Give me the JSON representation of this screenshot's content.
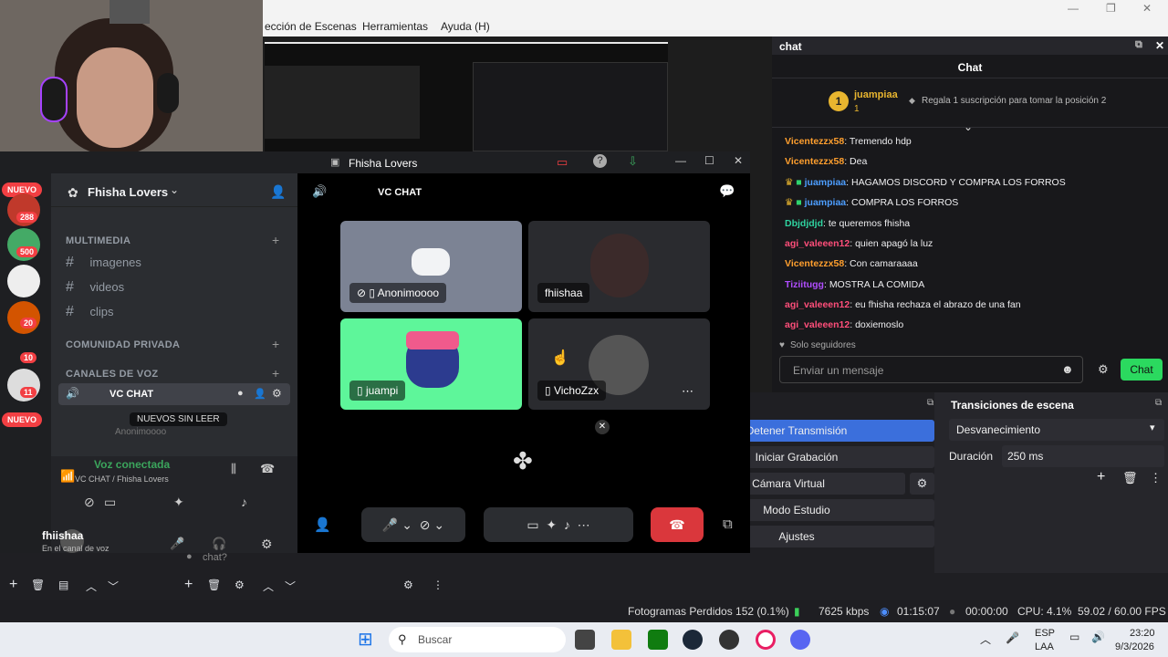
{
  "obs": {
    "menu": [
      "ección de Escenas",
      "Herramientas",
      "Ayuda (H)"
    ],
    "transitions": {
      "title": "Transiciones de escena",
      "selected": "Desvanecimiento",
      "duration_label": "Duración",
      "duration_value": "250 ms"
    },
    "controls": [
      "Detener Transmisión",
      "Iniciar Grabación",
      "ar Cámara Virtual",
      "Modo Estudio",
      "Ajustes"
    ],
    "scene_placeholder": "chat?",
    "status": {
      "dropped": "Fotogramas Perdidos 152 (0.1%)",
      "kbps": "7625 kbps",
      "live": "01:15:07",
      "rec": "00:00:00",
      "cpu": "CPU: 4.1%",
      "fps": "59.02 / 60.00 FPS"
    }
  },
  "chat": {
    "dock_title": "chat",
    "header": "Chat",
    "gift": {
      "rank": "1",
      "user": "juampiaa",
      "count": "1",
      "text": "Regala 1 suscripción para tomar la posición 2"
    },
    "messages": [
      {
        "user": "Vicentezzx58",
        "text": "Tremendo hdp",
        "color": "#ff9f2e"
      },
      {
        "user": "Vicentezzx58",
        "text": "Dea",
        "color": "#ff9f2e"
      },
      {
        "user": "juampiaa",
        "text": "HAGAMOS DISCORD Y COMPRA LOS FORROS",
        "color": "#4d9eff"
      },
      {
        "user": "juampiaa",
        "text": "COMPRA LOS FORROS",
        "color": "#4d9eff"
      },
      {
        "user": "Dbjdjdjd",
        "text": "te queremos fhisha",
        "color": "#2fd3a0"
      },
      {
        "user": "agi_valeeen12",
        "text": "quien apagó la luz",
        "color": "#ff4e7a"
      },
      {
        "user": "Vicentezzx58",
        "text": "Con camaraaaa",
        "color": "#ff9f2e"
      },
      {
        "user": "Tiziitugg",
        "text": "MOSTRA LA COMIDA",
        "color": "#b04dff"
      },
      {
        "user": "agi_valeeen12",
        "text": "eu fhisha rechaza el abrazo de una fan",
        "color": "#ff4e7a"
      },
      {
        "user": "agi_valeeen12",
        "text": "doxiemoslo",
        "color": "#ff4e7a"
      }
    ],
    "followers_only": "Solo seguidores",
    "input_placeholder": "Enviar un mensaje",
    "send_label": "Chat"
  },
  "discord": {
    "window_title": "Fhisha Lovers",
    "server_name": "Fhisha Lovers",
    "channel_header": "VC CHAT",
    "badges": {
      "nuevo": "NUEVO",
      "b1": "288",
      "b2": "500",
      "b3": "20",
      "b4": "10",
      "b5": "11"
    },
    "categories": {
      "multimedia": "MULTIMEDIA",
      "comunidad": "COMUNIDAD PRIVADA",
      "voz": "CANALES DE VOZ"
    },
    "channels": [
      "imagenes",
      "videos",
      "clips"
    ],
    "voice_channel": "VC CHAT",
    "voice_member": "Anonimoooo",
    "unread": "NUEVOS SIN LEER",
    "voice_status": "Voz conectada",
    "voice_location": "VC CHAT / Fhisha Lovers",
    "user": {
      "name": "fhiishaa",
      "status": "En el canal de voz"
    },
    "participants": [
      "Anonimoooo",
      "fhiishaa",
      "juampi",
      "VichoZzx"
    ]
  },
  "taskbar": {
    "search_placeholder": "Buscar",
    "lang": "ESP",
    "layout": "LAA",
    "time": "23:20",
    "date": "9/3/2026"
  }
}
